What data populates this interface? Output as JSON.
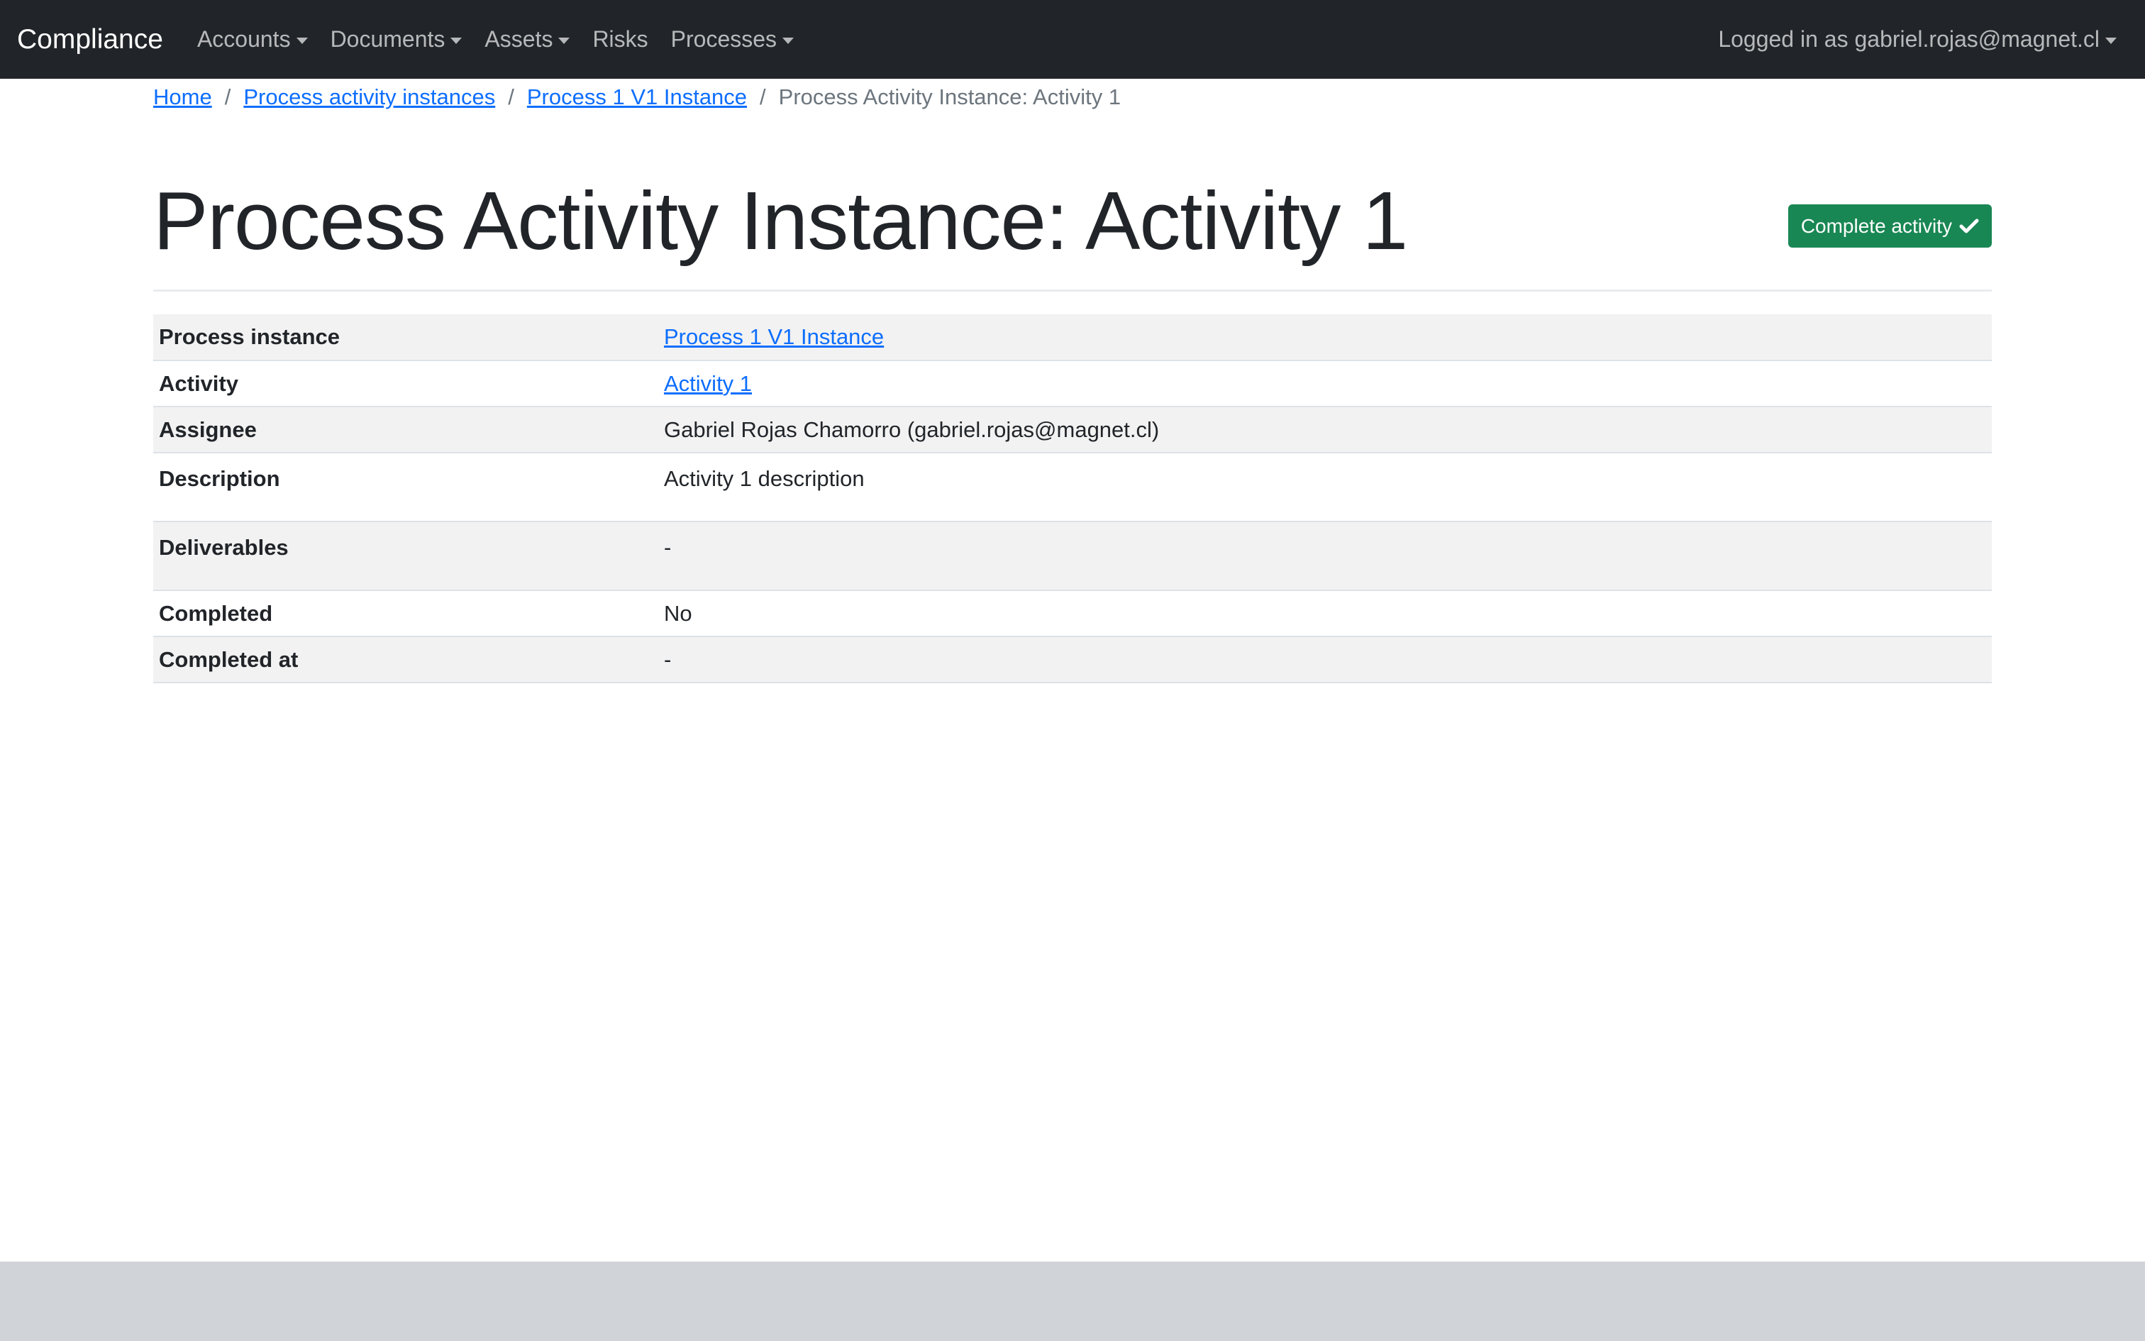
{
  "navbar": {
    "brand": "Compliance",
    "items": [
      {
        "label": "Accounts",
        "dropdown": true
      },
      {
        "label": "Documents",
        "dropdown": true
      },
      {
        "label": "Assets",
        "dropdown": true
      },
      {
        "label": "Risks",
        "dropdown": false
      },
      {
        "label": "Processes",
        "dropdown": true
      }
    ],
    "user_label": "Logged in as gabriel.rojas@magnet.cl"
  },
  "breadcrumb": {
    "items": [
      "Home",
      "Process activity instances",
      "Process 1 V1 Instance"
    ],
    "active": "Process Activity Instance: Activity 1",
    "separator": "/"
  },
  "page": {
    "title": "Process Activity Instance: Activity 1",
    "complete_button_label": "Complete activity"
  },
  "details": {
    "process_instance": {
      "label": "Process instance",
      "value": "Process 1 V1 Instance"
    },
    "activity": {
      "label": "Activity",
      "value": "Activity 1"
    },
    "assignee": {
      "label": "Assignee",
      "value": "Gabriel Rojas Chamorro (gabriel.rojas@magnet.cl)"
    },
    "description": {
      "label": "Description",
      "value": "Activity 1 description"
    },
    "deliverables": {
      "label": "Deliverables",
      "value": "-"
    },
    "completed": {
      "label": "Completed",
      "value": "No"
    },
    "completed_at": {
      "label": "Completed at",
      "value": "-"
    }
  },
  "colors": {
    "navbar_bg": "#212529",
    "link": "#0d6efd",
    "success": "#198754",
    "footer_bg": "#d0d4d8"
  }
}
